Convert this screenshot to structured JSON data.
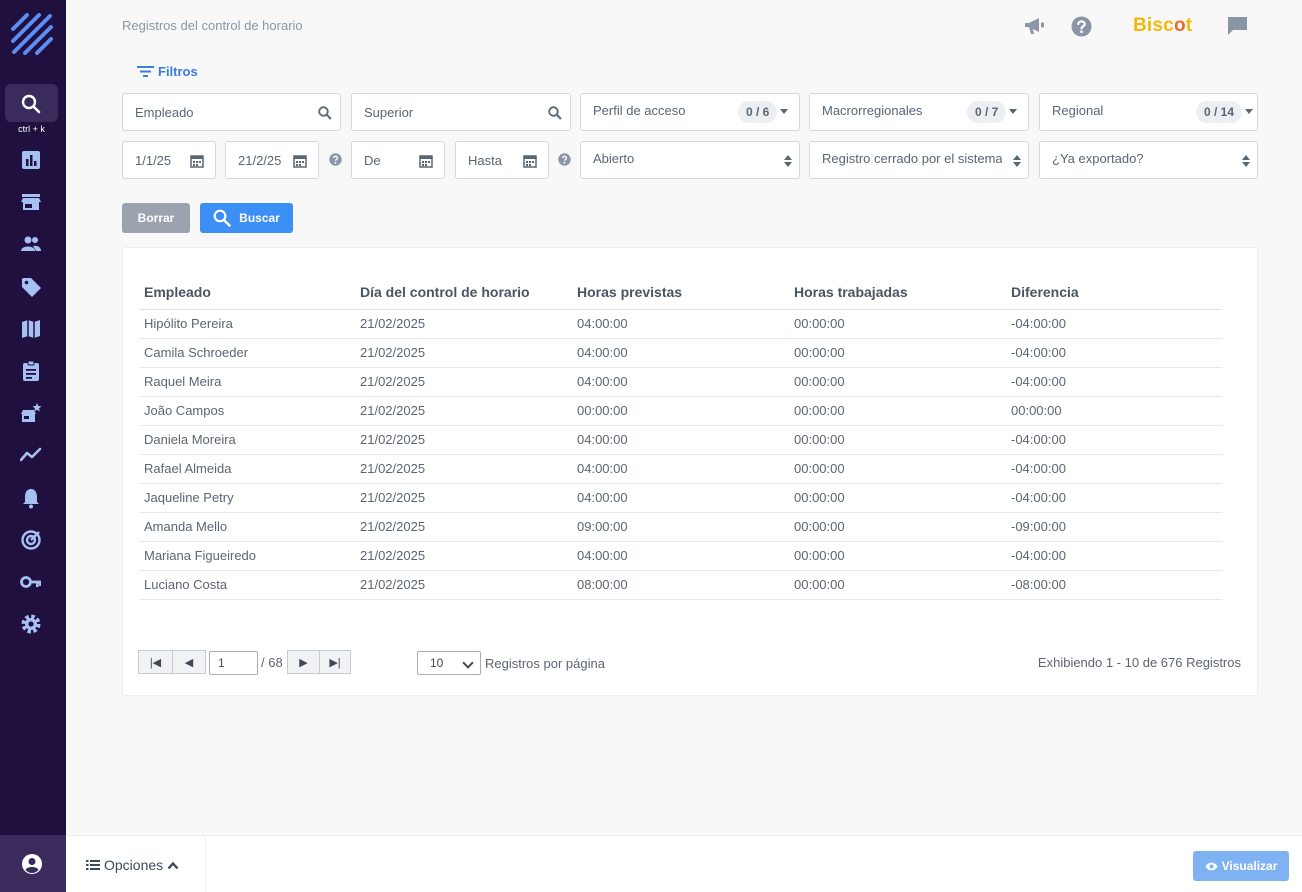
{
  "header": {
    "page_title": "Registros del control de horario",
    "brand_prefix": "Bisc",
    "brand_dot": "o",
    "brand_suffix": "t"
  },
  "sidebar": {
    "shortcut": "ctrl + k",
    "items": [
      "search-icon",
      "bar-chart-icon",
      "store-icon",
      "users-icon",
      "tag-icon",
      "map-icon",
      "clipboard-icon",
      "store-star-icon",
      "trend-icon",
      "bell-icon",
      "target-icon",
      "key-icon",
      "gear-icon"
    ]
  },
  "filters": {
    "toggle_label": "Filtros",
    "employee_placeholder": "Empleado",
    "superior_placeholder": "Superior",
    "access_profile": {
      "label": "Perfil de acceso",
      "count": "0 / 6"
    },
    "macroregional": {
      "label": "Macrorregionales",
      "count": "0 / 7"
    },
    "regional": {
      "label": "Regional",
      "count": "0 / 14"
    },
    "date_from": "1/1/25",
    "date_to": "21/2/25",
    "from_placeholder": "De",
    "to_placeholder": "Hasta",
    "status": "Abierto",
    "closed_by": "Registro cerrado por el sistema",
    "exported": "¿Ya exportado?",
    "clear_label": "Borrar",
    "search_label": "Buscar"
  },
  "table": {
    "headers": [
      "Empleado",
      "Día del control de horario",
      "Horas previstas",
      "Horas trabajadas",
      "Diferencia"
    ],
    "rows": [
      [
        "Hipólito Pereira",
        "21/02/2025",
        "04:00:00",
        "00:00:00",
        "-04:00:00"
      ],
      [
        "Camila Schroeder",
        "21/02/2025",
        "04:00:00",
        "00:00:00",
        "-04:00:00"
      ],
      [
        "Raquel Meira",
        "21/02/2025",
        "04:00:00",
        "00:00:00",
        "-04:00:00"
      ],
      [
        "João Campos",
        "21/02/2025",
        "00:00:00",
        "00:00:00",
        "00:00:00"
      ],
      [
        "Daniela Moreira",
        "21/02/2025",
        "04:00:00",
        "00:00:00",
        "-04:00:00"
      ],
      [
        "Rafael Almeida",
        "21/02/2025",
        "04:00:00",
        "00:00:00",
        "-04:00:00"
      ],
      [
        "Jaqueline Petry",
        "21/02/2025",
        "04:00:00",
        "00:00:00",
        "-04:00:00"
      ],
      [
        "Amanda Mello",
        "21/02/2025",
        "09:00:00",
        "00:00:00",
        "-09:00:00"
      ],
      [
        "Mariana Figueiredo",
        "21/02/2025",
        "04:00:00",
        "00:00:00",
        "-04:00:00"
      ],
      [
        "Luciano Costa",
        "21/02/2025",
        "08:00:00",
        "00:00:00",
        "-08:00:00"
      ]
    ]
  },
  "pager": {
    "page": "1",
    "total_pages": "/ 68",
    "per_page": "10",
    "per_page_label": "Registros por página",
    "showing": "Exhibiendo 1 - 10 de 676 Registros"
  },
  "footer": {
    "options_label": "Opciones",
    "visualize_label": "Visualizar"
  },
  "colors": {
    "sidebar_bg": "#1f1040",
    "accent": "#3b8ff5",
    "brand": "#f5b80a",
    "brand_dot": "#ee6a26"
  }
}
